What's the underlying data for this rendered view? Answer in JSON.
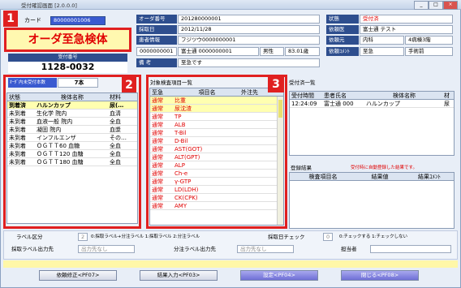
{
  "window": {
    "title": "受付確認画面 [2.0.0.0]",
    "minimize": "_",
    "maximize": "□",
    "close": "×"
  },
  "badges": [
    "1",
    "2",
    "3"
  ],
  "card": {
    "label": "カード",
    "value": "80000001006"
  },
  "urgent_text": "オーダ至急検体",
  "receipt": {
    "label": "受付番号",
    "value": "1128-0032"
  },
  "order_info": {
    "order_no_label": "オーダ番号",
    "order_no": "201280000001",
    "collect_date_label": "採取日",
    "collect_date": "2012/11/28",
    "patient_info_label": "患者情報",
    "patient_kana": "フジツウ0000000001",
    "patient_id": "0000000001",
    "patient_name": "富士通  0000000001",
    "sex": "男性",
    "age": "83.01歳",
    "note_label": "備 考",
    "note": "至急です"
  },
  "status_info": {
    "status_label": "状態",
    "status": "受付済",
    "requester_label": "依頼医",
    "requester": "富士通 テスト",
    "dept_label": "依頼元",
    "dept": "内科",
    "ward": "4病棟3階",
    "comment_label": "依頼ｺﾒﾝﾄ",
    "comment": "至急",
    "comment2": "手術前"
  },
  "panel2": {
    "count_label": "ｵｰﾀﾞ内未受付本数",
    "count": "7本",
    "headers": [
      "状態",
      "検体名称",
      "材料"
    ],
    "rows": [
      {
        "status": "到着済",
        "name": "ハルンカップ",
        "material": "尿(…"
      },
      {
        "status": "未到着",
        "name": "生化学 院内",
        "material": "血清"
      },
      {
        "status": "未到着",
        "name": "血液一般 院内",
        "material": "全血"
      },
      {
        "status": "未到着",
        "name": "凝固 院内",
        "material": "血漿"
      },
      {
        "status": "未到着",
        "name": "インフルエンザ",
        "material": "その…"
      },
      {
        "status": "未到着",
        "name": "ＯＧＴＴ60 血糖",
        "material": "全血"
      },
      {
        "status": "未到着",
        "name": "ＯＧＴＴ120 血糖",
        "material": "全血"
      },
      {
        "status": "未到着",
        "name": "ＯＧＴＴ180 血糖",
        "material": "全血"
      }
    ]
  },
  "panel_tests": {
    "title": "対象検査項目一覧",
    "headers": [
      "至急",
      "項目名",
      "外注先"
    ],
    "rows": [
      {
        "urgent": "通常",
        "name": "比重"
      },
      {
        "urgent": "通常",
        "name": "尿沈渣"
      },
      {
        "urgent": "通常",
        "name": "TP"
      },
      {
        "urgent": "通常",
        "name": "ALB"
      },
      {
        "urgent": "通常",
        "name": "T-Bil"
      },
      {
        "urgent": "通常",
        "name": "D-Bil"
      },
      {
        "urgent": "通常",
        "name": "AST(GOT)"
      },
      {
        "urgent": "通常",
        "name": "ALT(GPT)"
      },
      {
        "urgent": "通常",
        "name": "ALP"
      },
      {
        "urgent": "通常",
        "name": "Ch-e"
      },
      {
        "urgent": "通常",
        "name": "γ-GTP"
      },
      {
        "urgent": "通常",
        "name": "LD(LDH)"
      },
      {
        "urgent": "通常",
        "name": "CK(CPK)"
      },
      {
        "urgent": "通常",
        "name": "AMY"
      }
    ]
  },
  "panel3": {
    "title": "受付済一覧",
    "headers": [
      "受付時間",
      "患者氏名",
      "検体名称",
      "材"
    ],
    "rows": [
      {
        "time": "12:24:09",
        "patient": "富士通 000",
        "specimen": "ハルンカップ",
        "mat": "尿"
      }
    ],
    "reg_title": "登録結果",
    "reg_note": "受付時に自動登録した結果です。",
    "reg_headers": [
      "検査項目名",
      "結果値",
      "結果ｺﾒﾝﾄ"
    ]
  },
  "bottom": {
    "label_type_label": "ラベル区分",
    "label_type_value": "2",
    "label_type_desc": "0:採取ラベル+分注ラベル  1:採取ラベル  2:分注ラベル",
    "date_check_label": "採取日チェック",
    "date_check_value": "0",
    "date_check_desc": "0:チェックする 1:チェックしない",
    "collect_out_label": "採取ラベル出力先",
    "collect_out_value": "出力先なし",
    "dispense_out_label": "分注ラベル出力先",
    "dispense_out_value": "出力先なし",
    "person_label": "担当者"
  },
  "buttons": {
    "modify": "依頼修正<PF07>",
    "result": "結果入力<PF03>",
    "confirm": "設定<PF04>",
    "close": "閉じる<PF08>"
  }
}
